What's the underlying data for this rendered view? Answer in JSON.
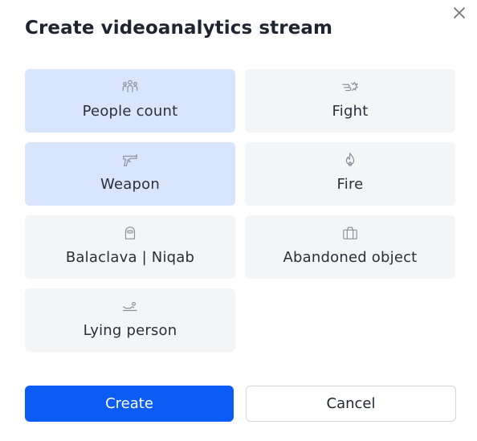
{
  "dialog": {
    "title": "Create videoanalytics stream",
    "close_icon": "close-icon"
  },
  "options": [
    {
      "label": "People count",
      "icon": "people-count-icon",
      "selected": true
    },
    {
      "label": "Fight",
      "icon": "fight-icon",
      "selected": false
    },
    {
      "label": "Weapon",
      "icon": "weapon-icon",
      "selected": true
    },
    {
      "label": "Fire",
      "icon": "fire-icon",
      "selected": false
    },
    {
      "label": "Balaclava | Niqab",
      "icon": "balaclava-icon",
      "selected": false
    },
    {
      "label": "Abandoned object",
      "icon": "abandoned-object-icon",
      "selected": false
    },
    {
      "label": "Lying person",
      "icon": "lying-person-icon",
      "selected": false
    }
  ],
  "actions": {
    "create_label": "Create",
    "cancel_label": "Cancel"
  },
  "colors": {
    "accent": "#0a5cf5",
    "selected_tile": "#d9e5fd",
    "tile": "#f4f5f7",
    "icon": "#8a909c"
  }
}
